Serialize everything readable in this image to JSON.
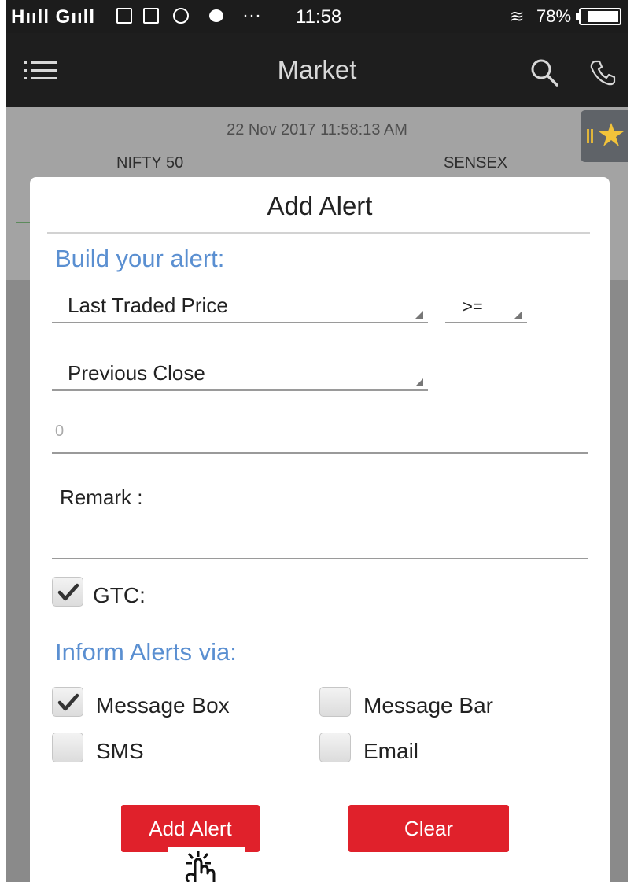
{
  "status_bar": {
    "signal": "H",
    "time": "11:58",
    "battery_pct": "78%",
    "dots": "···"
  },
  "app_bar": {
    "title": "Market"
  },
  "market": {
    "timestamp": "22 Nov 2017 11:58:13 AM",
    "index_1": "NIFTY 50",
    "index_2": "SENSEX"
  },
  "dialog": {
    "title": "Add Alert",
    "build_heading": "Build your alert:",
    "field_dropdown": "Last Traded Price",
    "operator_dropdown": ">=",
    "compare_dropdown": "Previous Close",
    "value_placeholder": "0",
    "remark_label": "Remark :",
    "gtc_label": "GTC:",
    "inform_heading": "Inform Alerts via:",
    "channels": {
      "message_box": "Message Box",
      "message_bar": "Message Bar",
      "sms": "SMS",
      "email": "Email"
    },
    "add_button": "Add Alert",
    "clear_button": "Clear"
  },
  "colors": {
    "accent_blue": "#5a8fd1",
    "button_red": "#e0212b",
    "app_bar": "#1e1e1e"
  },
  "icons": [
    "menu-icon",
    "search-icon",
    "phone-icon",
    "star-icon",
    "check-icon",
    "tap-cursor-icon"
  ]
}
